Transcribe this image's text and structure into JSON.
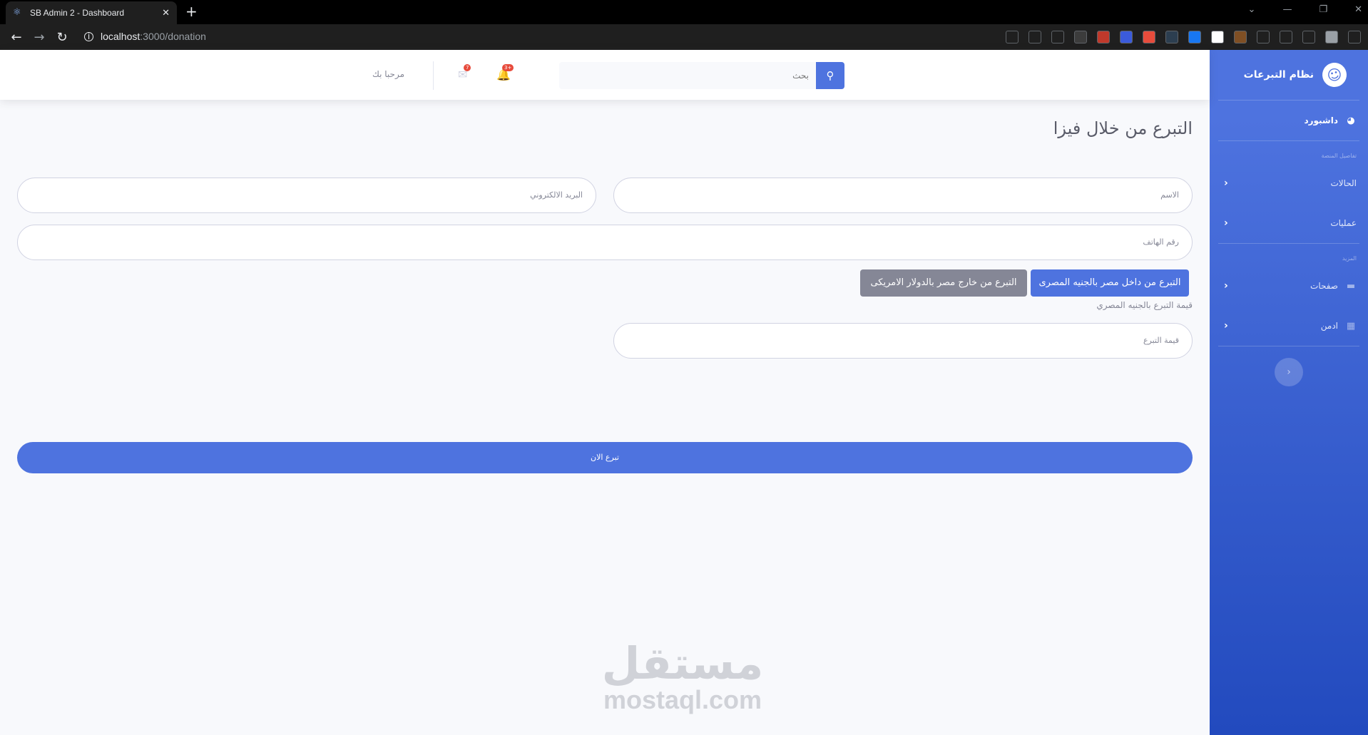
{
  "browser": {
    "tab_title": "SB Admin 2 - Dashboard",
    "url_host": "localhost",
    "url_path": ":3000/donation",
    "new_tab": "+",
    "extensions": [
      {
        "name": "download-icon",
        "color": "#1f1f1f"
      },
      {
        "name": "share-icon",
        "color": "#1f1f1f"
      },
      {
        "name": "star-icon",
        "color": "#1f1f1f"
      },
      {
        "name": "glasses-ext-icon",
        "color": "#3c3c3c"
      },
      {
        "name": "adblock-ext-icon",
        "color": "#c0392b"
      },
      {
        "name": "check-ext-icon",
        "color": "#3b5bdb"
      },
      {
        "name": "camera-ext-icon",
        "color": "#e74c3c"
      },
      {
        "name": "target-ext-icon",
        "color": "#2c3e50"
      },
      {
        "name": "fb-ext-icon",
        "color": "#1877f2"
      },
      {
        "name": "note-ext-icon",
        "color": "#ffffff"
      },
      {
        "name": "cookie-ext-icon",
        "color": "#7f4f24"
      },
      {
        "name": "puzzle-icon",
        "color": "#1f1f1f"
      },
      {
        "name": "downloads-icon",
        "color": "#1f1f1f"
      },
      {
        "name": "sidepanel-icon",
        "color": "#1f1f1f"
      },
      {
        "name": "profile-avatar-icon",
        "color": "#9aa0a6"
      },
      {
        "name": "menu-kebab-icon",
        "color": "#1f1f1f"
      }
    ]
  },
  "sidebar": {
    "brand": "نظام التبرعات",
    "dashboard": "داشبورد",
    "heading_1": "تفاصيل المنصة",
    "item_cases": "الحالات",
    "item_operations": "عمليات",
    "heading_2": "المزيد",
    "item_pages": "صفحات",
    "item_admin": "ادمن"
  },
  "topbar": {
    "search_placeholder": "بحث",
    "alerts_badge": "3+",
    "messages_badge": "7",
    "greeting": "مرحبا بك"
  },
  "form": {
    "title": "التبرع من خلال فيزا",
    "name_placeholder": "الاسم",
    "email_placeholder": "البريد الالكتروني",
    "phone_placeholder": "رقم الهاتف",
    "btn_egp": "التبرع من داخل مصر بالجنيه المصرى",
    "btn_usd": "التبرع من خارج مصر بالدولار الامريكى",
    "amount_label": "قيمة التبرع بالجنيه المصري",
    "amount_placeholder": "قيمة التبرع",
    "submit": "تبرع الان"
  },
  "watermark": {
    "arabic": "مستقل",
    "latin": "mostaql.com"
  }
}
